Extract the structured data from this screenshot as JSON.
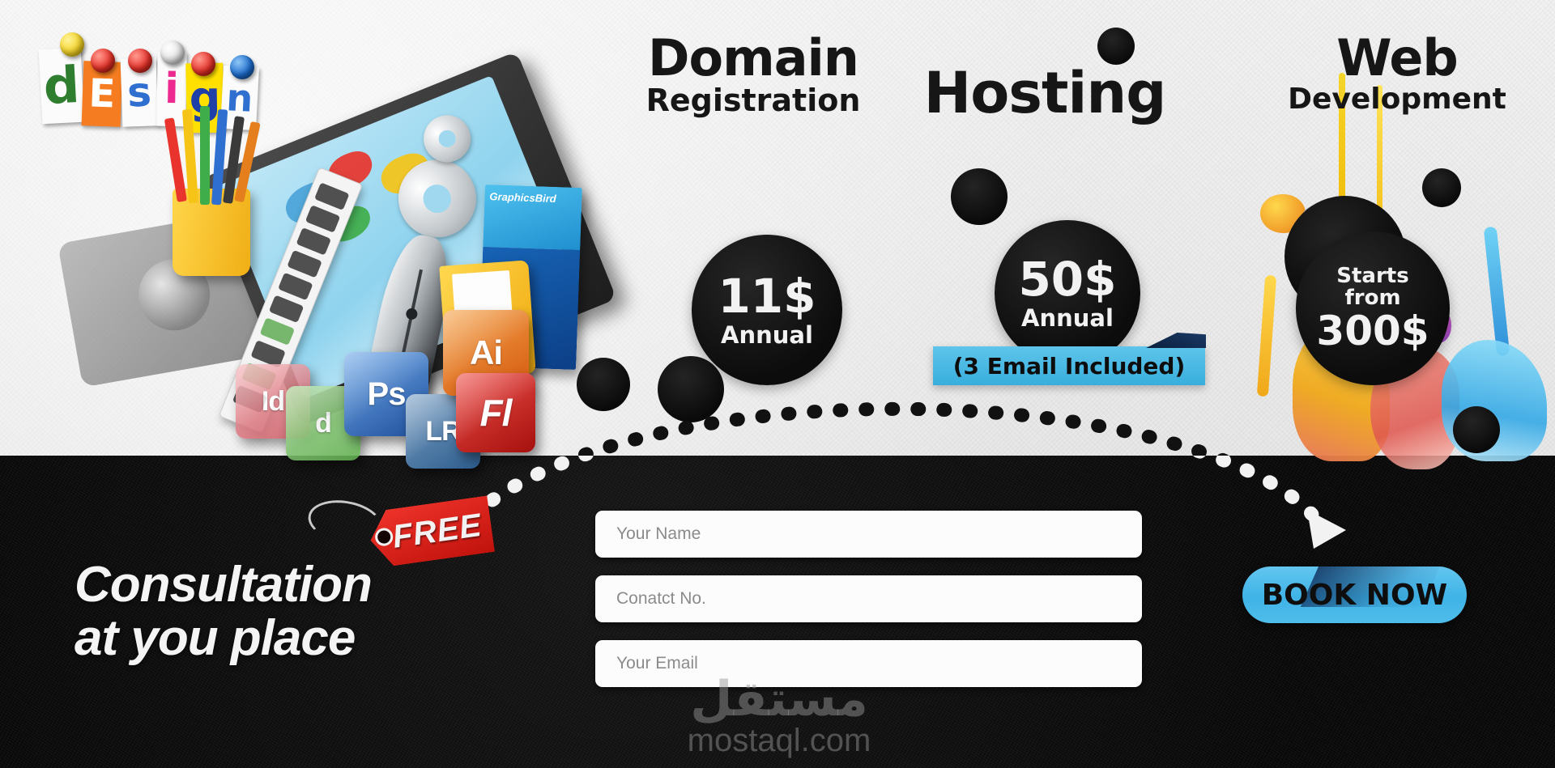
{
  "brand": {
    "logo_letters": [
      {
        "ch": "d",
        "color": "#2f7d2f",
        "bg": "#fbfbfb",
        "pin": "#f5d52a"
      },
      {
        "ch": "E",
        "color": "#ffffff",
        "bg": "#f57c20",
        "pin": "#e8332a"
      },
      {
        "ch": "s",
        "color": "#2f6fd0",
        "bg": "#fbfbfb",
        "pin": "#e8332a"
      },
      {
        "ch": "i",
        "color": "#ec2a8f",
        "bg": "#fbfbfb",
        "pin": "#ededed"
      },
      {
        "ch": "g",
        "color": "#1f3fa8",
        "bg": "#ffe000",
        "pin": "#e8332a"
      },
      {
        "ch": "n",
        "color": "#2f6fd0",
        "bg": "#fbfbfb",
        "pin": "#1f6fd0"
      }
    ],
    "logo_word": "design"
  },
  "services": [
    {
      "title_main": "Domain",
      "title_sub": "Registration",
      "price_amount": "11$",
      "price_period": "Annual",
      "note": ""
    },
    {
      "title_main": "Hosting",
      "title_sub": "",
      "price_amount": "50$",
      "price_period": "Annual",
      "note": "(3 Email Included)"
    },
    {
      "title_main": "Web",
      "title_sub": "Development",
      "price_prefix_1": "Starts",
      "price_prefix_2": "from",
      "price_amount": "300$",
      "price_period": "",
      "note": ""
    }
  ],
  "collage": {
    "software_box_title": "GraphicsBird",
    "app_cubes": [
      {
        "label": "Id",
        "color1": "#f3a6ab",
        "color2": "#c9555f"
      },
      {
        "label": "d",
        "color1": "#a9dd9a",
        "color2": "#5fae4e"
      },
      {
        "label": "Ps",
        "color1": "#6fa8e8",
        "color2": "#1f4f9c"
      },
      {
        "label": "LR",
        "color1": "#7fa3c6",
        "color2": "#2d5d8e"
      },
      {
        "label": "Ai",
        "color1": "#f5a44c",
        "color2": "#d4570e"
      },
      {
        "label": "Fl",
        "color1": "#ef4f4a",
        "color2": "#a5100d"
      }
    ]
  },
  "cta": {
    "headline_line1": "Consultation",
    "headline_line2": "at you place",
    "free_tag": "FREE",
    "button_label": "BOOK NOW",
    "form": {
      "name_placeholder": "Your Name",
      "contact_placeholder": "Conatct No.",
      "email_placeholder": "Your Email",
      "name_value": "",
      "contact_value": "",
      "email_value": ""
    }
  },
  "watermark": {
    "arabic": "مستقل",
    "latin": "mostaql.com"
  },
  "colors": {
    "accent_cyan": "#3fb3e6",
    "ribbon_cyan": "#4ab8e0",
    "tag_red": "#e0241c",
    "ink_black": "#0d0d0d",
    "panel_light": "#ececec",
    "panel_dark": "#0a0a0a"
  }
}
